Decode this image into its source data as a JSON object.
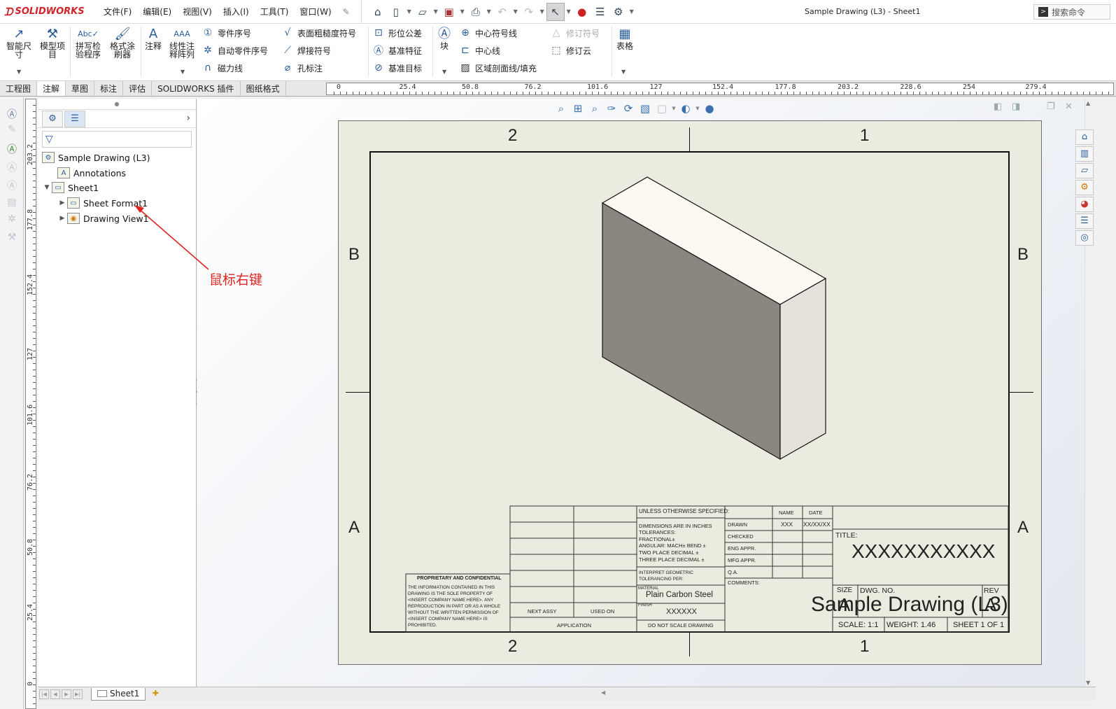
{
  "app": {
    "brand": "SOLIDWORKS",
    "window_title": "Sample Drawing (L3) - Sheet1",
    "search_placeholder": "搜索命令"
  },
  "menu": [
    {
      "label": "文件(F)"
    },
    {
      "label": "编辑(E)"
    },
    {
      "label": "视图(V)"
    },
    {
      "label": "插入(I)"
    },
    {
      "label": "工具(T)"
    },
    {
      "label": "窗口(W)"
    }
  ],
  "ribbon": {
    "smart_dimension": "智能尺寸",
    "model_items": "模型项目",
    "spell_checker": "拼写检验程序",
    "format_painter": "格式涂刷器",
    "note": "注释",
    "linear_note_pattern": "线性注释阵列",
    "balloon": "零件序号",
    "auto_balloon": "自动零件序号",
    "magnetic_line": "磁力线",
    "surface_finish": "表面粗糙度符号",
    "weld_symbol": "焊接符号",
    "hole_callout": "孔标注",
    "geometric_tolerance": "形位公差",
    "datum_feature": "基准特征",
    "datum_target": "基准目标",
    "block": "块",
    "center_mark": "中心符号线",
    "centerline": "中心线",
    "area_hatch": "区域剖面线/填充",
    "revision_symbol": "修订符号",
    "revision_cloud": "修订云",
    "tables": "表格"
  },
  "tabs": [
    {
      "label": "工程图",
      "active": false
    },
    {
      "label": "注解",
      "active": true
    },
    {
      "label": "草图",
      "active": false
    },
    {
      "label": "标注",
      "active": false
    },
    {
      "label": "评估",
      "active": false
    },
    {
      "label": "SOLIDWORKS 插件",
      "active": false
    },
    {
      "label": "图纸格式",
      "active": false
    }
  ],
  "h_ruler": [
    "0",
    "25.4",
    "50.8",
    "76.2",
    "101.6",
    "127",
    "152.4",
    "177.8",
    "203.2",
    "228.6",
    "254",
    "279.4"
  ],
  "v_ruler": [
    "203.2",
    "177.8",
    "152.4",
    "127",
    "101.6",
    "76.2",
    "50.8",
    "25.4",
    "0"
  ],
  "tree": {
    "root": "Sample Drawing (L3)",
    "annotations": "Annotations",
    "sheet": "Sheet1",
    "sheet_format": "Sheet Format1",
    "drawing_view": "Drawing View1"
  },
  "callout": {
    "text": "鼠标右键",
    "color": "#e0231f"
  },
  "sheet": {
    "zones_top": [
      "2",
      "1"
    ],
    "zones_side": [
      "B",
      "A"
    ],
    "title_block": {
      "unless_specified": "UNLESS OTHERWISE SPECIFIED:",
      "dims_in_inches": "DIMENSIONS ARE IN INCHES",
      "tolerances": "TOLERANCES:",
      "fractional": "FRACTIONAL±",
      "angular": "ANGULAR: MACH±    BEND ±",
      "two_place": "TWO PLACE DECIMAL    ±",
      "three_place": "THREE PLACE DECIMAL    ±",
      "interpret": "INTERPRET GEOMETRIC",
      "tolerancing_per": "TOLERANCING PER:",
      "material_label": "MATERIAL",
      "material": "Plain Carbon Steel",
      "finish_label": "FINISH",
      "finish": "XXXXXX",
      "do_not_scale": "DO NOT SCALE DRAWING",
      "next_assy": "NEXT ASSY",
      "used_on": "USED ON",
      "application": "APPLICATION",
      "name": "NAME",
      "date": "DATE",
      "drawn": "DRAWN",
      "drawn_name": "XXX",
      "drawn_date": "XX/XX/XX",
      "checked": "CHECKED",
      "eng_appr": "ENG APPR.",
      "mfg_appr": "MFG APPR.",
      "qa": "Q.A.",
      "comments": "COMMENTS:",
      "title_label": "TITLE:",
      "title_value": "XXXXXXXXXXX",
      "size_label": "SIZE",
      "size_value": "A",
      "dwg_no_label": "DWG.  NO.",
      "dwg_no_value": "Sample Drawing (L3)",
      "rev_label": "REV",
      "rev_value": "A",
      "scale": "SCALE: 1:1",
      "weight": "WEIGHT: 1.46",
      "sheet_of": "SHEET 1 OF 1",
      "proprietary_title": "PROPRIETARY AND CONFIDENTIAL",
      "proprietary_body": "THE INFORMATION CONTAINED IN THIS DRAWING IS THE SOLE PROPERTY OF <INSERT COMPANY NAME HERE>. ANY REPRODUCTION IN PART OR AS A WHOLE WITHOUT THE WRITTEN PERMISSION OF <INSERT COMPANY NAME HERE> IS PROHIBITED."
    }
  },
  "bottom": {
    "sheet_tab": "Sheet1"
  }
}
